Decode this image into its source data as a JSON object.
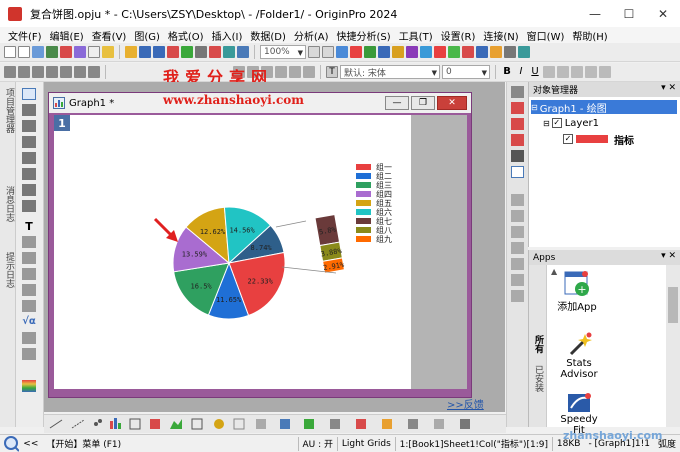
{
  "window": {
    "title": "复合饼图.opju * - C:\\Users\\ZSY\\Desktop\\ - /Folder1/ - OriginPro 2024",
    "minimize": "—",
    "maximize": "☐",
    "close": "✕"
  },
  "menubar": [
    "文件(F)",
    "编辑(E)",
    "查看(V)",
    "图(G)",
    "格式(O)",
    "插入(I)",
    "数据(D)",
    "分析(A)",
    "快捷分析(S)",
    "工具(T)",
    "设置(R)",
    "连接(N)",
    "窗口(W)",
    "帮助(H)"
  ],
  "toolbar": {
    "zoom": "100%",
    "font_name": "默认: 宋体",
    "font_size": "0"
  },
  "watermarks": {
    "top_cn": "我爱分享网",
    "url": "www.zhanshaoyi.com",
    "bottom": "zhanshaoyi.com"
  },
  "left_panels": [
    "项目管理器",
    "消息日志",
    "提示日志"
  ],
  "graph_window": {
    "title": "Graph1 *",
    "layer": "1",
    "feedback": ">>反馈"
  },
  "chart_data": {
    "type": "pie",
    "title": "",
    "slices": [
      {
        "label": "组一",
        "value": 8.74,
        "color": "#2e5f8a"
      },
      {
        "label": "组二",
        "value": 22.33,
        "color": "#e84040"
      },
      {
        "label": "组三",
        "value": 11.65,
        "color": "#1f6fd6"
      },
      {
        "label": "组四",
        "value": 16.5,
        "color": "#2fa060"
      },
      {
        "label": "组五",
        "value": 13.59,
        "color": "#a96cd0"
      },
      {
        "label": "组六",
        "value": 12.62,
        "color": "#d4a414"
      },
      {
        "label": "组七",
        "value": 14.56,
        "color": "#21c4c4"
      }
    ],
    "slice_labels": [
      "8.74%",
      "22.33%",
      "11.65%",
      "16.5%",
      "13.59%",
      "12.62%",
      "14.56%"
    ],
    "bar_of_pie": [
      {
        "label": "组七",
        "value": 6.8,
        "display": "5.8%",
        "color": "#6a3a3a"
      },
      {
        "label": "组八",
        "value": 3.88,
        "display": "3.88%",
        "color": "#8a8a1a"
      },
      {
        "label": "组九",
        "value": 2.91,
        "display": "2.91%",
        "color": "#ff6a00"
      }
    ],
    "legend": [
      "组一",
      "组二",
      "组三",
      "组四",
      "组五",
      "组六",
      "组七",
      "组八",
      "组九"
    ],
    "legend_colors": [
      "#e84040",
      "#1f6fd6",
      "#2fa060",
      "#a96cd0",
      "#d4a414",
      "#21c4c4",
      "#6a3a3a",
      "#8a8a1a",
      "#ff6a00"
    ],
    "legend_placement": "top-right"
  },
  "object_manager": {
    "title": "对象管理器",
    "graph_node": "Graph1 - 绘图",
    "layer_node": "Layer1",
    "plot_node": "指标"
  },
  "apps": {
    "title": "Apps",
    "items": [
      "添加App",
      "Stats Advisor",
      "Speedy Fit"
    ],
    "side_tabs": [
      "所有",
      "已安装"
    ]
  },
  "statusbar": {
    "start": "【开始】菜单 (F1)",
    "au": "AU : 开",
    "grids": "Light Grids",
    "ref": "1:[Book1]Sheet1!Col(\"指标\")[1:9]",
    "mem": "18KB",
    "graph": "- [Graph1]1!1",
    "unit": "弧度"
  }
}
